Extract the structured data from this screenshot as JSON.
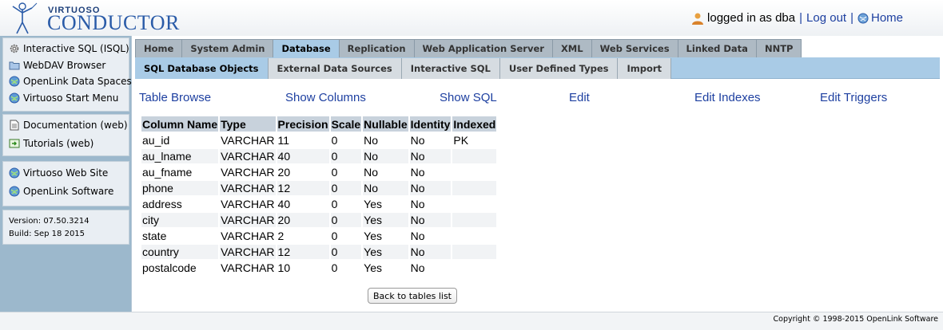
{
  "header": {
    "logo_small": "VIRTUOSO",
    "logo_big": "CONDUCTOR",
    "logged_in_text": "logged in as dba",
    "logout_label": "Log out",
    "separator": "|",
    "home_label": "Home"
  },
  "sidebar": {
    "group1": [
      {
        "label": "Interactive SQL (ISQL)",
        "icon": "gear-icon"
      },
      {
        "label": "WebDAV Browser",
        "icon": "folder-icon"
      },
      {
        "label": "OpenLink Data Spaces",
        "icon": "globe-icon"
      },
      {
        "label": "Virtuoso Start Menu",
        "icon": "globe-icon"
      }
    ],
    "group2": [
      {
        "label": "Documentation (web)",
        "icon": "document-icon"
      },
      {
        "label": "Tutorials (web)",
        "icon": "tutorial-icon"
      }
    ],
    "group3": [
      {
        "label": "Virtuoso Web Site",
        "icon": "globe-icon"
      },
      {
        "label": "OpenLink Software",
        "icon": "globe-icon"
      }
    ],
    "version": "Version: 07.50.3214",
    "build": "Build: Sep 18 2015"
  },
  "tabs_main": [
    "Home",
    "System Admin",
    "Database",
    "Replication",
    "Web Application Server",
    "XML",
    "Web Services",
    "Linked Data",
    "NNTP"
  ],
  "tabs_main_active": "Database",
  "tabs_sub": [
    "SQL Database Objects",
    "External Data Sources",
    "Interactive SQL",
    "User Defined Types",
    "Import"
  ],
  "tabs_sub_active": "SQL Database Objects",
  "actions": [
    "Table Browse",
    "Show Columns",
    "Show SQL",
    "Edit",
    "Edit Indexes",
    "Edit Triggers"
  ],
  "table": {
    "headers": [
      "Column Name",
      "Type",
      "Precision",
      "Scale",
      "Nullable",
      "Identity",
      "Indexed"
    ],
    "rows": [
      [
        "au_id",
        "VARCHAR",
        "11",
        "0",
        "No",
        "No",
        "PK"
      ],
      [
        "au_lname",
        "VARCHAR",
        "40",
        "0",
        "No",
        "No",
        ""
      ],
      [
        "au_fname",
        "VARCHAR",
        "20",
        "0",
        "No",
        "No",
        ""
      ],
      [
        "phone",
        "VARCHAR",
        "12",
        "0",
        "No",
        "No",
        ""
      ],
      [
        "address",
        "VARCHAR",
        "40",
        "0",
        "Yes",
        "No",
        ""
      ],
      [
        "city",
        "VARCHAR",
        "20",
        "0",
        "Yes",
        "No",
        ""
      ],
      [
        "state",
        "VARCHAR",
        "2",
        "0",
        "Yes",
        "No",
        ""
      ],
      [
        "country",
        "VARCHAR",
        "12",
        "0",
        "Yes",
        "No",
        ""
      ],
      [
        "postalcode",
        "VARCHAR",
        "10",
        "0",
        "Yes",
        "No",
        ""
      ]
    ]
  },
  "back_button": "Back to tables list",
  "footer": {
    "copyright": "Copyright © 1998-2015 OpenLink Software"
  },
  "colors": {
    "link": "#1d3fa0",
    "sidebar_bg": "#9cb8cc",
    "active_tab": "#a9cbe6",
    "header_cell": "#c8d2dc"
  }
}
